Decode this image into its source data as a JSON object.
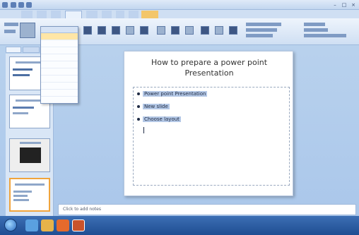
{
  "slide": {
    "title_line1": "How to prepare a power point",
    "title_line2": "Presentation",
    "bullets": [
      "Power point Presentation",
      "New slide",
      "Choose layout"
    ]
  },
  "notes": {
    "placeholder": "Click to add notes"
  },
  "colors": {
    "ribbon": "#cfdff3",
    "selection": "#b4c8e6",
    "menu_highlight": "#ffe6a6",
    "taskbar": "#1f4d92"
  },
  "icons": [
    "office-button-icon",
    "save-icon",
    "undo-icon",
    "redo-icon",
    "new-slide-icon",
    "start-orb-icon",
    "explorer-icon",
    "media-player-icon",
    "powerpoint-icon"
  ]
}
